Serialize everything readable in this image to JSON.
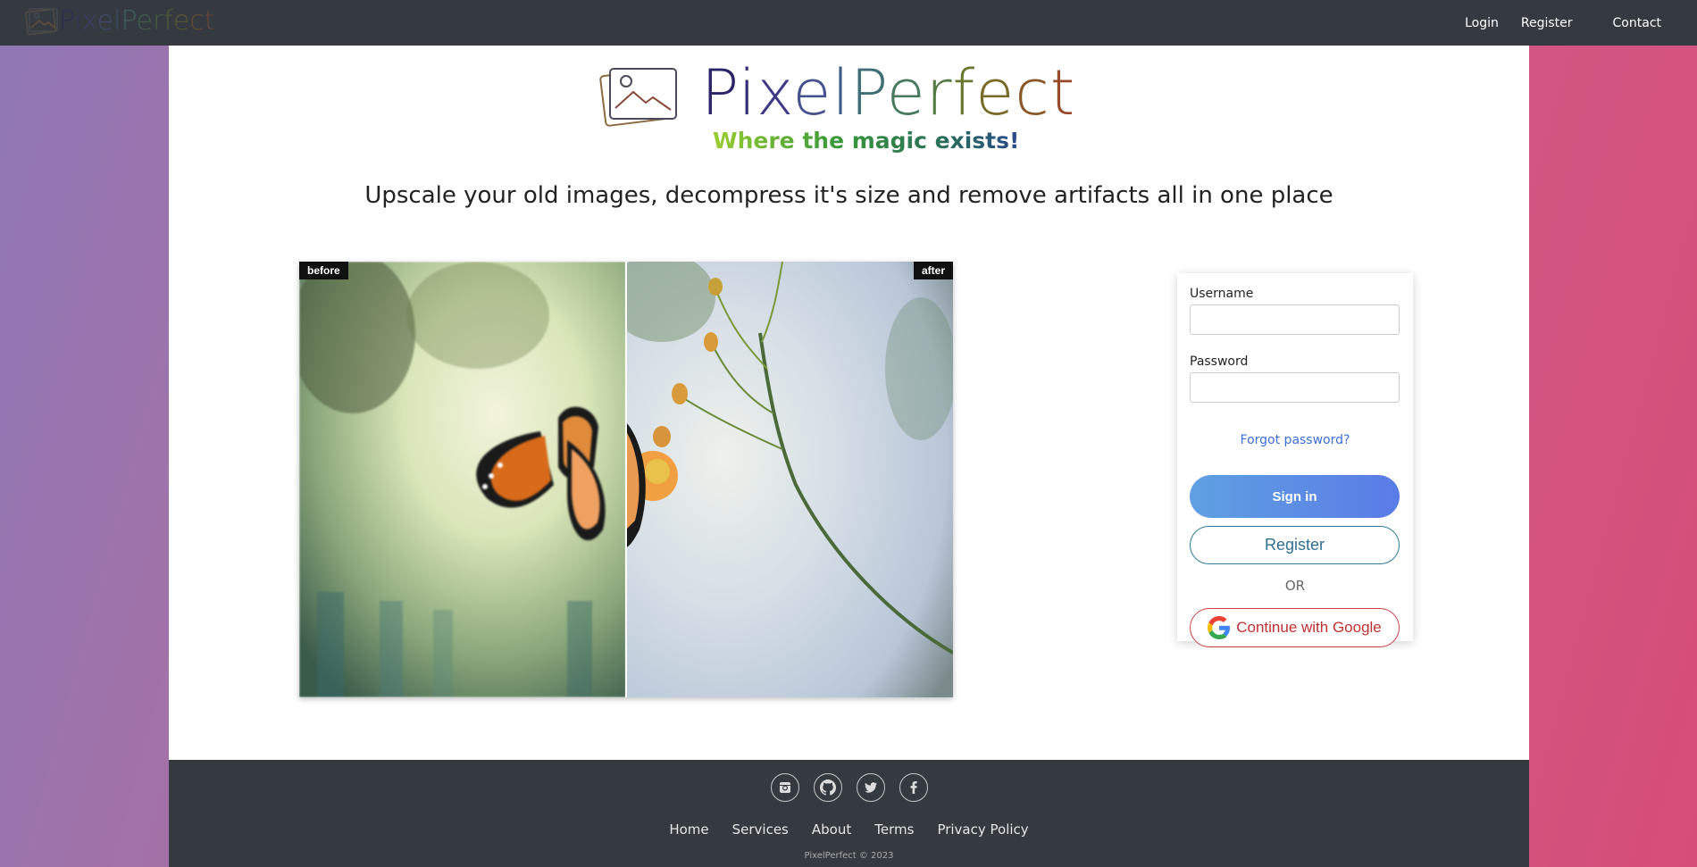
{
  "nav": {
    "brand": "PixelPerfect",
    "links": [
      "Login",
      "Register",
      "Contact"
    ]
  },
  "logo": {
    "text": "PixelPerfect",
    "tagline": "Where the magic exists!"
  },
  "headline": "Upscale your old images, decompress it's size and remove artifacts all in one place",
  "compare": {
    "before_label": "before",
    "after_label": "after",
    "split_fraction": 0.5
  },
  "login": {
    "username_label": "Username",
    "username_value": "",
    "password_label": "Password",
    "password_value": "",
    "forgot": "Forgot password?",
    "signin": "Sign in",
    "register": "Register",
    "or": "OR",
    "google": "Continue with Google"
  },
  "footer": {
    "socials": [
      "instagram-icon",
      "github-icon",
      "twitter-icon",
      "facebook-icon"
    ],
    "links": [
      "Home",
      "Services",
      "About",
      "Terms",
      "Privacy Policy"
    ],
    "copyright": "PixelPerfect © 2023"
  },
  "colors": {
    "navbar": "#343a40",
    "accent_blue": "#5a7be6",
    "google_red": "#c03030"
  }
}
